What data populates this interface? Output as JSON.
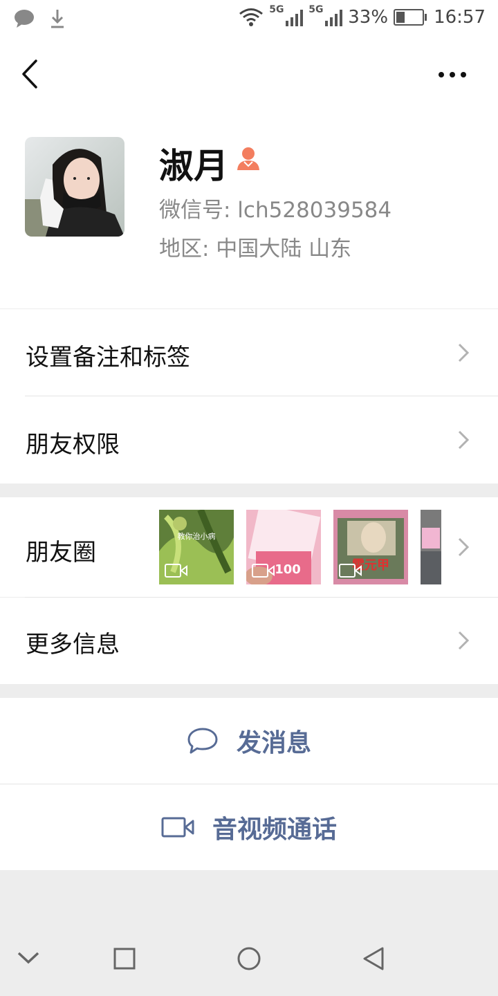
{
  "status_bar": {
    "battery_percent": "33%",
    "battery_level": 0.33,
    "time": "16:57",
    "network_1": "5G",
    "network_2": "5G",
    "icons": [
      "chat-notification-icon",
      "download-icon",
      "wifi-icon",
      "signal-icon",
      "battery-icon"
    ]
  },
  "profile": {
    "name": "淑月",
    "wechat_id": "微信号: lch528039584",
    "region": "地区: 中国大陆  山东",
    "gender_icon": "female-icon",
    "gender_color": "#f37e5f"
  },
  "menu": {
    "remarks_tags": "设置备注和标签",
    "friend_permissions": "朋友权限",
    "moments": "朋友圈",
    "more_info": "更多信息"
  },
  "moments_thumbs": [
    {
      "type": "video",
      "caption": "教你治小病"
    },
    {
      "type": "video",
      "caption": "100"
    },
    {
      "type": "video",
      "caption": "霍元甲"
    },
    {
      "type": "image"
    }
  ],
  "actions": {
    "send_message": "发消息",
    "video_call": "音视频通话"
  },
  "colors": {
    "link_blue": "#576b95",
    "background": "#ededed"
  }
}
